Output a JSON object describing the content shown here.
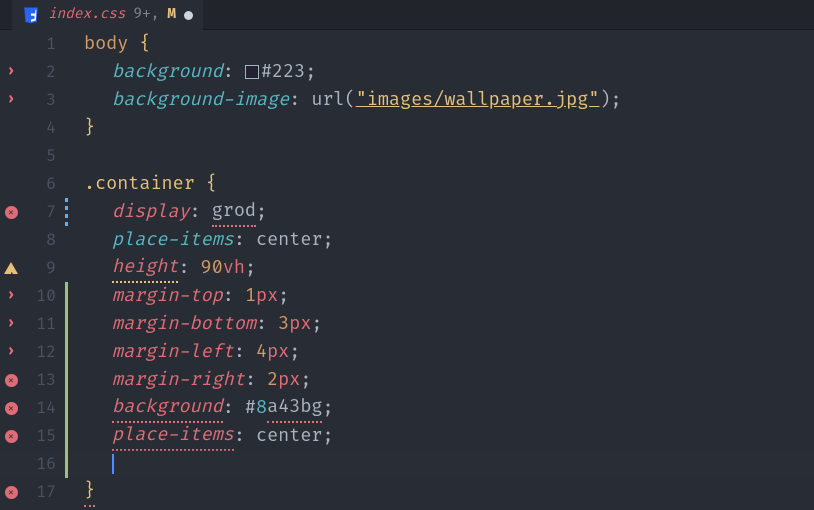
{
  "tab": {
    "filename": "index.css",
    "diff_indicator": "9+,",
    "git_status": "M"
  },
  "lines": [
    {
      "n": 1,
      "gutter": "",
      "mod": "",
      "tokens": [
        [
          "sel",
          "body "
        ],
        [
          "brace",
          "{"
        ]
      ]
    },
    {
      "n": 2,
      "gutter": "chevron",
      "mod": "",
      "indent": 1,
      "tokens": [
        [
          "prop",
          "background"
        ],
        [
          "plain",
          ": "
        ],
        [
          "swatch",
          "#222233"
        ],
        [
          "hash",
          "#223"
        ],
        [
          "plain",
          ";"
        ]
      ]
    },
    {
      "n": 3,
      "gutter": "chevron",
      "mod": "",
      "indent": 1,
      "tokens": [
        [
          "prop",
          "background-image"
        ],
        [
          "plain",
          ": url("
        ],
        [
          "str",
          "\"images/wallpaper.jpg\""
        ],
        [
          "plain",
          ");"
        ]
      ]
    },
    {
      "n": 4,
      "gutter": "",
      "mod": "",
      "tokens": [
        [
          "brace",
          "}"
        ]
      ]
    },
    {
      "n": 5,
      "gutter": "",
      "mod": "",
      "tokens": []
    },
    {
      "n": 6,
      "gutter": "",
      "mod": "",
      "tokens": [
        [
          "sel-c",
          ".container "
        ],
        [
          "brace",
          "{"
        ]
      ]
    },
    {
      "n": 7,
      "gutter": "error",
      "mod": "blue",
      "indent": 1,
      "tokens": [
        [
          "propr",
          "display"
        ],
        [
          "plain",
          ": "
        ],
        [
          "err",
          "grod"
        ],
        [
          "plain",
          ";"
        ]
      ]
    },
    {
      "n": 8,
      "gutter": "",
      "mod": "",
      "indent": 1,
      "tokens": [
        [
          "prop",
          "place-items"
        ],
        [
          "plain",
          ": center;"
        ]
      ]
    },
    {
      "n": 9,
      "gutter": "warn",
      "mod": "",
      "indent": 1,
      "tokens": [
        [
          "propr-w",
          "height"
        ],
        [
          "plain",
          ": "
        ],
        [
          "num",
          "90"
        ],
        [
          "unit",
          "vh"
        ],
        [
          "plain",
          ";"
        ]
      ]
    },
    {
      "n": 10,
      "gutter": "chevron",
      "mod": "green",
      "indent": 1,
      "tokens": [
        [
          "propr",
          "margin-top"
        ],
        [
          "plain",
          ": "
        ],
        [
          "num",
          "1"
        ],
        [
          "unit",
          "px"
        ],
        [
          "plain",
          ";"
        ]
      ]
    },
    {
      "n": 11,
      "gutter": "chevron",
      "mod": "green",
      "indent": 1,
      "tokens": [
        [
          "propr",
          "margin-bottom"
        ],
        [
          "plain",
          ": "
        ],
        [
          "num",
          "3"
        ],
        [
          "unit",
          "px"
        ],
        [
          "plain",
          ";"
        ]
      ]
    },
    {
      "n": 12,
      "gutter": "chevron",
      "mod": "green",
      "indent": 1,
      "tokens": [
        [
          "propr",
          "margin-left"
        ],
        [
          "plain",
          ": "
        ],
        [
          "num",
          "4"
        ],
        [
          "unit",
          "px"
        ],
        [
          "plain",
          ";"
        ]
      ]
    },
    {
      "n": 13,
      "gutter": "error",
      "mod": "green",
      "indent": 1,
      "tokens": [
        [
          "propr",
          "margin-right"
        ],
        [
          "plain",
          ": "
        ],
        [
          "num",
          "2"
        ],
        [
          "unit",
          "px"
        ],
        [
          "plain",
          ";"
        ]
      ]
    },
    {
      "n": 14,
      "gutter": "error",
      "mod": "green",
      "indent": 1,
      "tokens": [
        [
          "propr-e",
          "background"
        ],
        [
          "plain",
          ": #"
        ],
        [
          "hash-b",
          "8"
        ],
        [
          "err2",
          "a43bg"
        ],
        [
          "plain",
          ";"
        ]
      ]
    },
    {
      "n": 15,
      "gutter": "error",
      "mod": "green",
      "indent": 1,
      "tokens": [
        [
          "propr-e",
          "place-items"
        ],
        [
          "plain",
          ": center;"
        ]
      ]
    },
    {
      "n": 16,
      "gutter": "",
      "mod": "green",
      "indent": 1,
      "cursor": true,
      "tokens": []
    },
    {
      "n": 17,
      "gutter": "error",
      "mod": "",
      "tokens": [
        [
          "brace-e",
          "}"
        ]
      ]
    }
  ]
}
